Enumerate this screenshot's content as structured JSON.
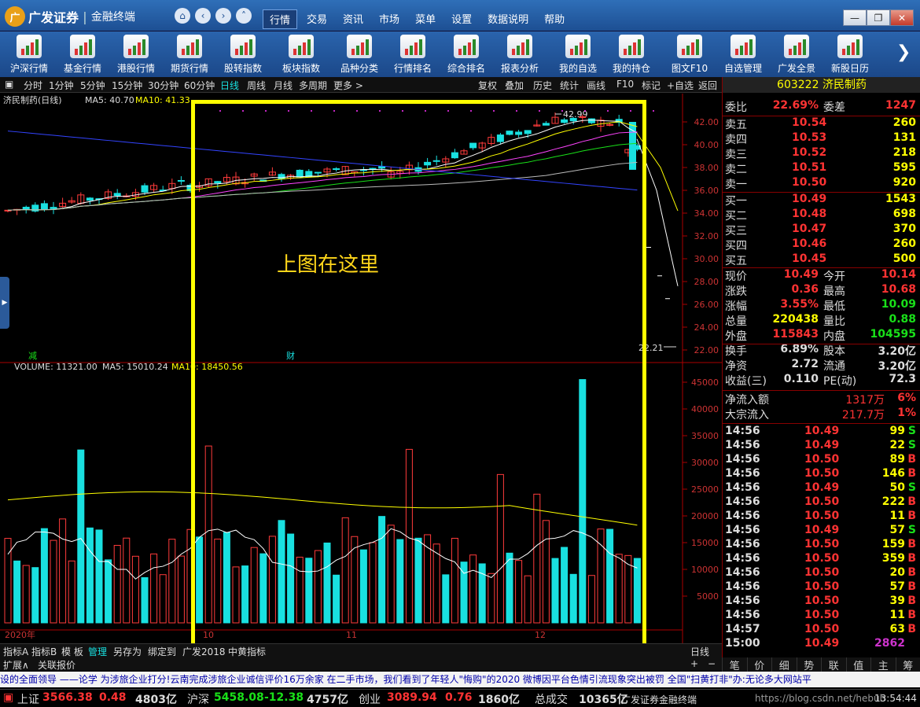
{
  "titlebar": {
    "logo_mark": "广",
    "brand": "广发证券",
    "product": "金融终端",
    "menu": [
      {
        "label": "行情",
        "active": true
      },
      {
        "label": "交易"
      },
      {
        "label": "资讯"
      },
      {
        "label": "市场"
      },
      {
        "label": "菜单"
      },
      {
        "label": "设置"
      },
      {
        "label": "数据说明"
      },
      {
        "label": "帮助"
      }
    ],
    "window_buttons": [
      "minimize-icon",
      "restore-icon",
      "close-icon"
    ]
  },
  "toolbar": {
    "items": [
      "沪深行情",
      "基金行情",
      "港股行情",
      "期货行情",
      "股转指数",
      "板块指数",
      "品种分类",
      "行情排名",
      "综合排名",
      "报表分析",
      "我的自选",
      "我的持仓",
      "图文F10",
      "自选管理",
      "广发全景",
      "新股日历"
    ]
  },
  "periodbar": {
    "items": [
      "分时",
      "1分钟",
      "5分钟",
      "15分钟",
      "30分钟",
      "60分钟",
      "日线",
      "周线",
      "月线",
      "多周期",
      "更多 >"
    ],
    "selected": "日线",
    "right": [
      "复权",
      "叠加",
      "历史",
      "统计",
      "画线",
      "F10",
      "标记",
      "+自选",
      "返回"
    ]
  },
  "kline": {
    "stock_label": "济民制药(日线)",
    "ma5": "MA5: 40.70",
    "ma10": "MA10: 41.33",
    "high_label": "42.99",
    "low_label": "22.21",
    "event1": "减",
    "event2": "财",
    "yticks": [
      "42.00",
      "40.00",
      "38.00",
      "36.00",
      "34.00",
      "32.00",
      "30.00",
      "28.00",
      "26.00",
      "24.00",
      "22.00"
    ]
  },
  "volume": {
    "label": "VOLUME: 11321.00",
    "ma5": "MA5: 15010.24",
    "ma10": "MA10: 18450.56",
    "yticks": [
      "45000",
      "40000",
      "35000",
      "30000",
      "25000",
      "20000",
      "15000",
      "10000",
      "5000"
    ],
    "xlabels": [
      "2020年",
      "10",
      "11",
      "12"
    ],
    "period": "日线"
  },
  "highlight": {
    "text": "上图在这里"
  },
  "bottomtabs": [
    "指标A",
    "指标B",
    "模 板",
    "管理",
    "另存为",
    "绑定到",
    "广发2018",
    "中黄指标"
  ],
  "subbar2": [
    "扩展∧",
    "关联报价"
  ],
  "quote": {
    "title": "603222 济民制药",
    "weibi": {
      "label": "委比",
      "value": "22.69%",
      "label2": "委差",
      "value2": "1247"
    },
    "asks": [
      {
        "label": "卖五",
        "price": "10.54",
        "vol": "260"
      },
      {
        "label": "卖四",
        "price": "10.53",
        "vol": "131"
      },
      {
        "label": "卖三",
        "price": "10.52",
        "vol": "218"
      },
      {
        "label": "卖二",
        "price": "10.51",
        "vol": "595"
      },
      {
        "label": "卖一",
        "price": "10.50",
        "vol": "920"
      }
    ],
    "bids": [
      {
        "label": "买一",
        "price": "10.49",
        "vol": "1543"
      },
      {
        "label": "买二",
        "price": "10.48",
        "vol": "698"
      },
      {
        "label": "买三",
        "price": "10.47",
        "vol": "370"
      },
      {
        "label": "买四",
        "price": "10.46",
        "vol": "260"
      },
      {
        "label": "买五",
        "price": "10.45",
        "vol": "500"
      }
    ],
    "stats": [
      {
        "l1": "现价",
        "v1": "10.49",
        "l2": "今开",
        "v2": "10.14"
      },
      {
        "l1": "涨跌",
        "v1": "0.36",
        "l2": "最高",
        "v2": "10.68"
      },
      {
        "l1": "涨幅",
        "v1": "3.55%",
        "l2": "最低",
        "v2": "10.09"
      },
      {
        "l1": "总量",
        "v1": "220438",
        "l2": "量比",
        "v2": "0.88"
      },
      {
        "l1": "外盘",
        "v1": "115843",
        "l2": "内盘",
        "v2": "104595"
      },
      {
        "l1": "换手",
        "v1": "6.89%",
        "l2": "股本",
        "v2": "3.20亿"
      },
      {
        "l1": "净资",
        "v1": "2.72",
        "l2": "流通",
        "v2": "3.20亿"
      },
      {
        "l1": "收益(三)",
        "v1": "0.110",
        "l2": "PE(动)",
        "v2": "72.3"
      }
    ],
    "flows": [
      {
        "label": "净流入额",
        "value": "1317万",
        "pct": "6%"
      },
      {
        "label": "大宗流入",
        "value": "217.7万",
        "pct": "1%"
      }
    ],
    "ticks": [
      {
        "t": "14:56",
        "p": "10.49",
        "v": "99",
        "s": "S"
      },
      {
        "t": "14:56",
        "p": "10.49",
        "v": "22",
        "s": "S"
      },
      {
        "t": "14:56",
        "p": "10.50",
        "v": "89",
        "s": "B"
      },
      {
        "t": "14:56",
        "p": "10.50",
        "v": "146",
        "s": "B"
      },
      {
        "t": "14:56",
        "p": "10.49",
        "v": "50",
        "s": "S"
      },
      {
        "t": "14:56",
        "p": "10.50",
        "v": "222",
        "s": "B"
      },
      {
        "t": "14:56",
        "p": "10.50",
        "v": "11",
        "s": "B"
      },
      {
        "t": "14:56",
        "p": "10.49",
        "v": "57",
        "s": "S"
      },
      {
        "t": "14:56",
        "p": "10.50",
        "v": "159",
        "s": "B"
      },
      {
        "t": "14:56",
        "p": "10.50",
        "v": "359",
        "s": "B"
      },
      {
        "t": "14:56",
        "p": "10.50",
        "v": "20",
        "s": "B"
      },
      {
        "t": "14:56",
        "p": "10.50",
        "v": "57",
        "s": "B"
      },
      {
        "t": "14:56",
        "p": "10.50",
        "v": "39",
        "s": "B"
      },
      {
        "t": "14:56",
        "p": "10.50",
        "v": "11",
        "s": "B"
      },
      {
        "t": "14:57",
        "p": "10.50",
        "v": "63",
        "s": "B"
      },
      {
        "t": "15:00",
        "p": "10.49",
        "v": "2862",
        "s": ""
      }
    ]
  },
  "rbtns": [
    "笔",
    "价",
    "细",
    "势",
    "联",
    "值",
    "主",
    "筹"
  ],
  "news": "设的全面领导   ——论学          为涉旅企业打分!云南完成涉旅企业诚信评价16万余家            在二手市场，我们看到了年轻人\"悔购\"的2020            微博因平台色情引流现象突出被罚  全国\"扫黄打非\"办:无论多大网站平",
  "status": {
    "sh_label": "上证",
    "sh_val": "3566.38",
    "sh_chg": "0.48",
    "sh_amt": "4803亿",
    "hs_label": "沪深",
    "hs_val": "5458.08",
    "hs_chg": "-12.38",
    "hs_amt": "4757亿",
    "cy_label": "创业",
    "cy_val": "3089.94",
    "cy_chg": "0.76",
    "cy_amt": "1860亿",
    "total_label": "总成交",
    "total_val": "10365亿",
    "brand": "广发证券金融终端",
    "watermark": "https://blog.csdn.net/hebub",
    "time": "13:54:44"
  },
  "colors": {
    "up": "#ff3b3b",
    "down": "#19e0e0",
    "ma5": "#ffffff",
    "ma10": "#ffff00",
    "highlight": "#ffff00"
  }
}
